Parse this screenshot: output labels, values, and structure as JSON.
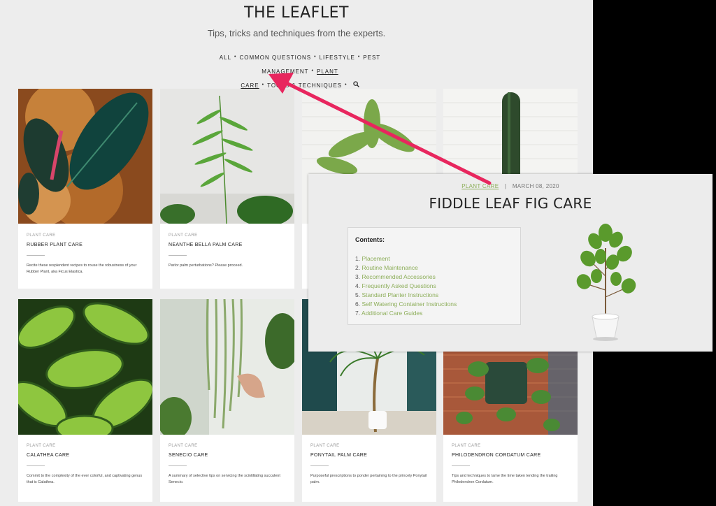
{
  "site": {
    "title": "THE LEAFLET",
    "tagline": "Tips, tricks and techniques from the experts."
  },
  "nav": {
    "items": [
      "All",
      "Common Questions",
      "Lifestyle",
      "Pest Management",
      "Plant",
      "Care",
      "Tools & Techniques"
    ],
    "active": "Plant Care",
    "search_icon": "search-icon"
  },
  "cards": [
    {
      "category": "Plant Care",
      "title": "Rubber Plant Care",
      "description": "Recite these resplendent recipes to rouse the robustness of your Rubber Plant, aka Ficus Elastica."
    },
    {
      "category": "Plant Care",
      "title": "Neanthe Bella Palm Care",
      "description": "Parlor palm perturbations? Please proceed."
    },
    {
      "category": "Plant Care",
      "title": "Calathea Care",
      "description": "Commit to the complexity of the ever colorful, and captivating genus that is Calathea."
    },
    {
      "category": "Plant Care",
      "title": "Senecio Care",
      "description": "A summary of selective tips on servicing the scintillating succulent Senecio."
    },
    {
      "category": "Plant Care",
      "title": "Ponytail Palm Care",
      "description": "Purposeful prescriptions to ponder pertaining to the princely Ponytail palm."
    },
    {
      "category": "Plant Care",
      "title": "Philodendron Cordatum Care",
      "description": "Tips and techniques to tame the time taken tending the trailing Philodendron Cordatum."
    }
  ],
  "overlay": {
    "category": "PLANT CARE",
    "separator": "|",
    "date": "MARCH 08, 2020",
    "title": "FIDDLE LEAF FIG CARE",
    "contents_heading": "Contents:",
    "contents": [
      {
        "num": "1.",
        "label": "Placement"
      },
      {
        "num": "2.",
        "label": "Routine Maintenance"
      },
      {
        "num": "3.",
        "label": "Recommended Accessories"
      },
      {
        "num": "4.",
        "label": "Frequently Asked Questions"
      },
      {
        "num": "5.",
        "label": "Standard Planter Instructions"
      },
      {
        "num": "6.",
        "label": "Self Watering Container Instructions"
      },
      {
        "num": "7.",
        "label": "Additional Care Guides"
      }
    ]
  },
  "colors": {
    "accent_green": "#8dae5a",
    "arrow": "#e8265e"
  }
}
